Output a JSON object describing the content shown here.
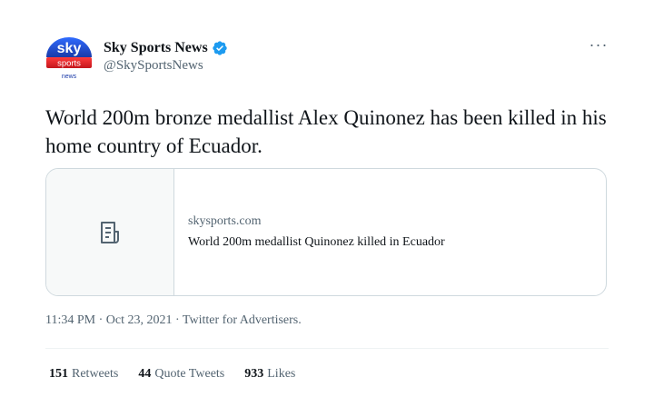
{
  "author": {
    "name": "Sky Sports News",
    "handle": "@SkySportsNews",
    "avatar": {
      "top_text": "sky",
      "middle_text": "sports",
      "bottom_text": "news",
      "colors": {
        "blue": "#1d4fd8",
        "red": "#e0222a"
      }
    },
    "verified": true
  },
  "menu_icon": "more-options-icon",
  "tweet": {
    "text": "World 200m bronze medallist Alex Quinonez has been killed in his home country of Ecuador."
  },
  "link_card": {
    "icon": "article-icon",
    "domain": "skysports.com",
    "title": "World 200m medallist Quinonez killed in Ecuador"
  },
  "meta": {
    "time": "11:34 PM",
    "sep1": "·",
    "date": "Oct 23, 2021",
    "sep2": "·",
    "source": "Twitter for Advertisers."
  },
  "stats": {
    "retweets": {
      "count": "151",
      "label": "Retweets"
    },
    "quotes": {
      "count": "44",
      "label": "Quote Tweets"
    },
    "likes": {
      "count": "933",
      "label": "Likes"
    }
  },
  "colors": {
    "verified": "#1d9bf0",
    "secondary_text": "#536471"
  }
}
